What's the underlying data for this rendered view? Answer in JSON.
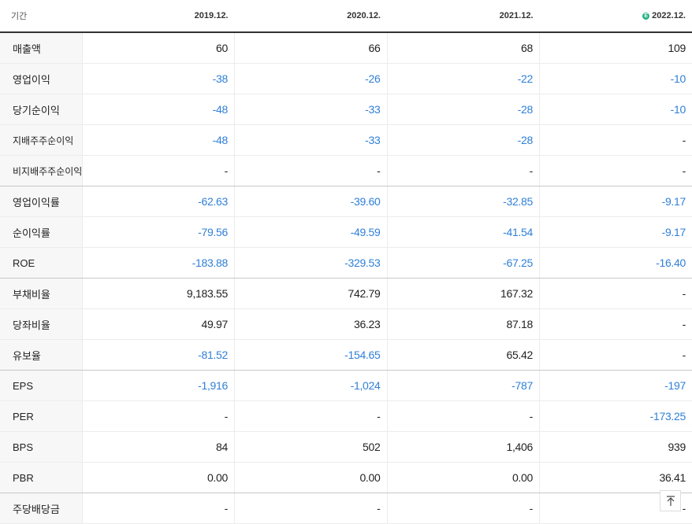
{
  "header": {
    "label": "기간",
    "periods": [
      "2019.12.",
      "2020.12.",
      "2021.12.",
      "2022.12."
    ],
    "estimate_badge": "E"
  },
  "rows": [
    {
      "label": "매출액",
      "values": [
        "60",
        "66",
        "68",
        "109"
      ],
      "small": false,
      "group_end": false
    },
    {
      "label": "영업이익",
      "values": [
        "-38",
        "-26",
        "-22",
        "-10"
      ],
      "small": false,
      "group_end": false
    },
    {
      "label": "당기순이익",
      "values": [
        "-48",
        "-33",
        "-28",
        "-10"
      ],
      "small": false,
      "group_end": false
    },
    {
      "label": "지배주주순이익",
      "values": [
        "-48",
        "-33",
        "-28",
        "-"
      ],
      "small": true,
      "group_end": false
    },
    {
      "label": "비지배주주순이익",
      "values": [
        "-",
        "-",
        "-",
        "-"
      ],
      "small": true,
      "group_end": true
    },
    {
      "label": "영업이익률",
      "values": [
        "-62.63",
        "-39.60",
        "-32.85",
        "-9.17"
      ],
      "small": false,
      "group_end": false
    },
    {
      "label": "순이익률",
      "values": [
        "-79.56",
        "-49.59",
        "-41.54",
        "-9.17"
      ],
      "small": false,
      "group_end": false
    },
    {
      "label": "ROE",
      "values": [
        "-183.88",
        "-329.53",
        "-67.25",
        "-16.40"
      ],
      "small": false,
      "group_end": true
    },
    {
      "label": "부채비율",
      "values": [
        "9,183.55",
        "742.79",
        "167.32",
        "-"
      ],
      "small": false,
      "group_end": false
    },
    {
      "label": "당좌비율",
      "values": [
        "49.97",
        "36.23",
        "87.18",
        "-"
      ],
      "small": false,
      "group_end": false
    },
    {
      "label": "유보율",
      "values": [
        "-81.52",
        "-154.65",
        "65.42",
        "-"
      ],
      "small": false,
      "group_end": true
    },
    {
      "label": "EPS",
      "values": [
        "-1,916",
        "-1,024",
        "-787",
        "-197"
      ],
      "small": false,
      "group_end": false
    },
    {
      "label": "PER",
      "values": [
        "-",
        "-",
        "-",
        "-173.25"
      ],
      "small": false,
      "group_end": false
    },
    {
      "label": "BPS",
      "values": [
        "84",
        "502",
        "1,406",
        "939"
      ],
      "small": false,
      "group_end": false
    },
    {
      "label": "PBR",
      "values": [
        "0.00",
        "0.00",
        "0.00",
        "36.41"
      ],
      "small": false,
      "group_end": true
    },
    {
      "label": "주당배당금",
      "values": [
        "-",
        "-",
        "-",
        "-"
      ],
      "small": false,
      "group_end": false
    }
  ],
  "scroll_top_icon": "arrow-up-icon",
  "colors": {
    "negative": "#2f7fd8",
    "estimate": "#21b07f"
  }
}
